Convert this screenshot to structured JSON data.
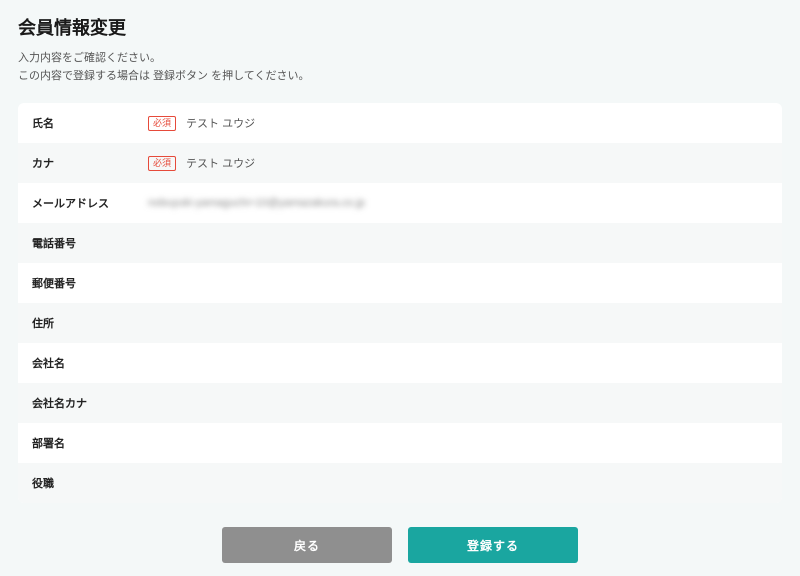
{
  "page": {
    "title": "会員情報変更",
    "description_line1": "入力内容をご確認ください。",
    "description_line2": "この内容で登録する場合は 登録ボタン を押してください。"
  },
  "badges": {
    "required": "必須"
  },
  "fields": {
    "name": {
      "label": "氏名",
      "value": "テスト ユウジ",
      "required": true
    },
    "kana": {
      "label": "カナ",
      "value": "テスト ユウジ",
      "required": true
    },
    "email": {
      "label": "メールアドレス",
      "value": "nobuyuki-yamaguchi+10@yamazakura.co.jp",
      "required": false
    },
    "phone": {
      "label": "電話番号",
      "value": "",
      "required": false
    },
    "postal": {
      "label": "郵便番号",
      "value": "",
      "required": false
    },
    "address": {
      "label": "住所",
      "value": "",
      "required": false
    },
    "company": {
      "label": "会社名",
      "value": "",
      "required": false
    },
    "company_kana": {
      "label": "会社名カナ",
      "value": "",
      "required": false
    },
    "department": {
      "label": "部署名",
      "value": "",
      "required": false
    },
    "position": {
      "label": "役職",
      "value": "",
      "required": false
    }
  },
  "buttons": {
    "back": "戻る",
    "submit": "登録する"
  }
}
